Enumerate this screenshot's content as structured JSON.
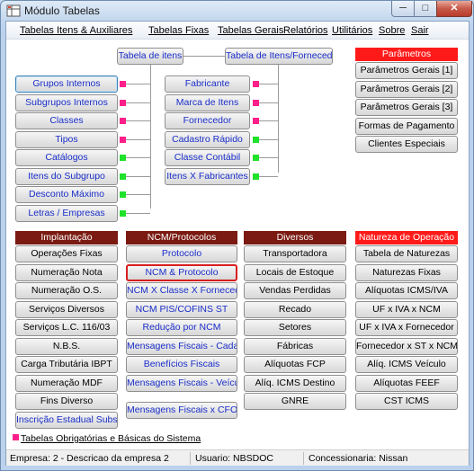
{
  "window": {
    "title": "Módulo Tabelas",
    "min": "─",
    "max": "□",
    "close": "✕"
  },
  "menu": [
    "Tabelas Itens & Auxiliares",
    "Tabelas Fixas",
    "Tabelas Gerais",
    "Relatórios",
    "Utilitários",
    "Sobre",
    "Sair"
  ],
  "tree": {
    "root_left": "Tabela de itens",
    "root_right": "Tabela de Itens/Fornecedor",
    "left": [
      {
        "label": "Grupos Internos",
        "color": "#ff1f8a"
      },
      {
        "label": "Subgrupos Internos",
        "color": "#ff1f8a"
      },
      {
        "label": "Classes",
        "color": "#ff1f8a"
      },
      {
        "label": "Tipos",
        "color": "#ff1f8a"
      },
      {
        "label": "Catálogos",
        "color": "#1fe22a"
      },
      {
        "label": "Itens do Subgrupo",
        "color": "#1fe22a"
      },
      {
        "label": "Desconto Máximo",
        "color": "#1fe22a"
      },
      {
        "label": "Letras / Empresas",
        "color": "#1fe22a"
      }
    ],
    "right": [
      {
        "label": "Fabricante",
        "color": "#ff1f8a"
      },
      {
        "label": "Marca de Itens",
        "color": "#ff1f8a"
      },
      {
        "label": "Fornecedor",
        "color": "#ff1f8a"
      },
      {
        "label": "Cadastro Rápido",
        "color": "#1fe22a"
      },
      {
        "label": "Classe Contábil",
        "color": "#1fe22a"
      },
      {
        "label": "Itens X Fabricantes",
        "color": "#1fe22a"
      }
    ]
  },
  "parametros": {
    "header": "Parâmetros",
    "items": [
      "Parâmetros Gerais [1]",
      "Parâmetros Gerais [2]",
      "Parâmetros Gerais [3]",
      "Formas de Pagamento",
      "Clientes Especiais"
    ]
  },
  "implantacao": {
    "header": "Implantação",
    "items": [
      "Operações Fixas",
      "Numeração Nota",
      "Numeração O.S.",
      "Serviços Diversos",
      "Serviços L.C. 116/03",
      "N.B.S.",
      "Carga Tributária IBPT",
      "Numeração MDF",
      "Fins Diverso",
      "Inscrição Estadual Subst."
    ]
  },
  "ncm": {
    "header": "NCM/Protocolos",
    "items": [
      "Protocolo",
      "NCM & Protocolo",
      "NCM X Classe X Fornecedor",
      "NCM PIS/COFINS ST",
      "Redução por NCM",
      "Mensagens Fiscais - Cadastro",
      "Benefícios Fiscais",
      "Mensagens Fiscais - Veículos",
      "Mensagens Fiscais x CFOP"
    ]
  },
  "diversos": {
    "header": "Diversos",
    "items": [
      "Transportadora",
      "Locais de Estoque",
      "Vendas Perdidas",
      "Recado",
      "Setores",
      "Fábricas",
      "Alíquotas FCP",
      "Alíq. ICMS Destino",
      "GNRE"
    ]
  },
  "natureza": {
    "header": "Natureza de Operação",
    "items": [
      "Tabela de Naturezas",
      "Naturezas Fixas",
      "Alíquotas ICMS/IVA",
      "UF x IVA x NCM",
      "UF x IVA x Fornecedor",
      "Fornecedor x ST x NCM",
      "Alíq. ICMS Veículo",
      "Alíquotas FEEF",
      "CST ICMS"
    ]
  },
  "legend": {
    "text": "Tabelas Obrigatórias e Básicas do Sistema",
    "color": "#ff1f8a"
  },
  "status": {
    "empresa": "Empresa: 2 - Descricao da empresa 2",
    "usuario": "Usuario: NBSDOC",
    "concessionaria": "Concessionaria: Nissan"
  }
}
